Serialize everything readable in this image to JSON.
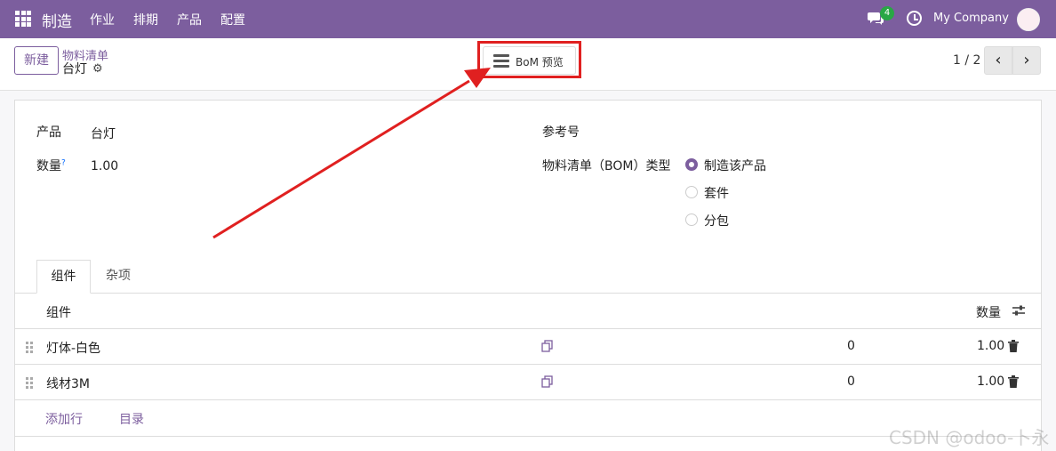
{
  "navbar": {
    "app_name": "制造",
    "menu": [
      "作业",
      "排期",
      "产品",
      "配置"
    ],
    "chat_badge": "4",
    "company": "My Company"
  },
  "control_panel": {
    "new_label": "新建",
    "breadcrumb_parent": "物料清单",
    "breadcrumb_current": "台灯",
    "bom_overview_label": "BoM 预览",
    "pager": "1 / 2"
  },
  "form": {
    "product_label": "产品",
    "product_value": "台灯",
    "quantity_label": "数量",
    "quantity_help": "?",
    "quantity_value": "1.00",
    "reference_label": "参考号",
    "bom_type_label": "物料清单（BOM）类型",
    "bom_type_options": [
      {
        "label": "制造该产品",
        "checked": true
      },
      {
        "label": "套件",
        "checked": false
      },
      {
        "label": "分包",
        "checked": false
      }
    ]
  },
  "tabs": [
    {
      "label": "组件",
      "active": true
    },
    {
      "label": "杂项",
      "active": false
    }
  ],
  "table": {
    "headers": {
      "component": "组件",
      "quantity": "数量"
    },
    "rows": [
      {
        "component": "灯体-白色",
        "col3": "0",
        "quantity": "1.00"
      },
      {
        "component": "线材3M",
        "col3": "0",
        "quantity": "1.00"
      }
    ],
    "add_line_label": "添加行",
    "catalog_label": "目录"
  },
  "watermark": "CSDN @odoo-卜永",
  "colors": {
    "brand": "#7c5e9e",
    "annotation": "#e02020"
  }
}
